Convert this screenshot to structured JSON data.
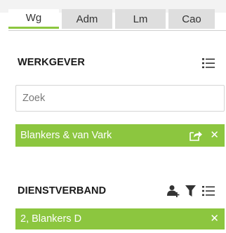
{
  "tabs": [
    {
      "label": "Wg",
      "active": true
    },
    {
      "label": "Adm",
      "active": false
    },
    {
      "label": "Lm",
      "active": false
    },
    {
      "label": "Cao",
      "active": false
    }
  ],
  "werkgever": {
    "title": "WERKGEVER",
    "search_placeholder": "Zoek",
    "selected": "Blankers & van Vark"
  },
  "dienstverband": {
    "title": "DIENSTVERBAND",
    "selected": "2, Blankers D"
  },
  "icons": {
    "list": "list-icon",
    "open": "open-external-icon",
    "close": "close-icon",
    "add_person": "add-person-icon",
    "filter": "filter-icon"
  },
  "colors": {
    "accent": "#8cc63f",
    "tab_inactive": "#dedede"
  }
}
